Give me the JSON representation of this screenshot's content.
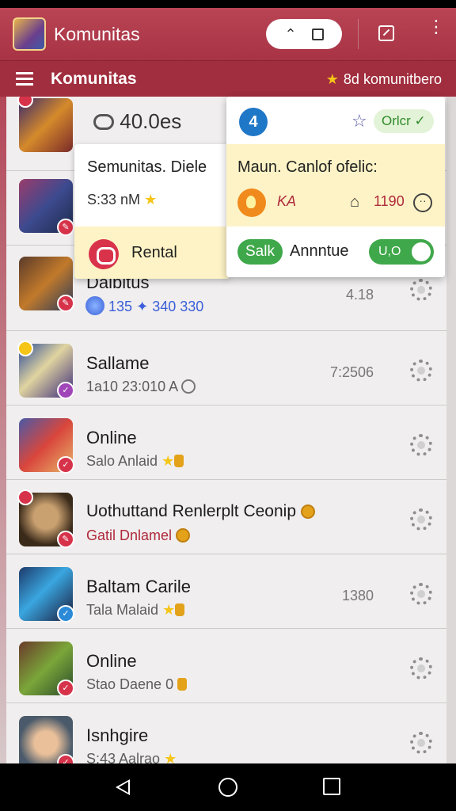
{
  "app_bar": {
    "title": "Komunitas"
  },
  "sub_bar": {
    "title": "Komunitas",
    "right_label": "8d komunitbero"
  },
  "rows": [
    {
      "title": "40.0es",
      "subtitle": "S:33 nM",
      "meta": ""
    },
    {
      "title": "Dalbitus",
      "subtitle": "135",
      "subtitle2": "340 330",
      "meta": "4.18"
    },
    {
      "title": "Sallame",
      "subtitle": "1a10 23:010 A",
      "meta": "7:2506"
    },
    {
      "title": "Online",
      "subtitle": "Salo Anlaid",
      "meta": ""
    },
    {
      "title": "Uothuttand Renlerplt Ceonip",
      "subtitle": "Gatil Dnlamel",
      "meta": ""
    },
    {
      "title": "Baltam Carile",
      "subtitle": "Tala Malaid",
      "meta": "1380"
    },
    {
      "title": "Online",
      "subtitle": "Stao Daene 0",
      "meta": ""
    },
    {
      "title": "Isnhgire",
      "subtitle": "S:43 Aalrao",
      "meta": ""
    }
  ],
  "popup_left": {
    "title": "Semunitas. Diele",
    "subtitle": "S:33 nM",
    "footer_label": "Rental"
  },
  "popup_right": {
    "avatar": "4",
    "status": "Orlcr ✓",
    "title": "Maun. Canlof ofelic:",
    "label": "KA",
    "number": "1190",
    "pill": "Salk",
    "footer_label": "Annntue",
    "toggle": "U,O"
  },
  "colors": {
    "accent": "#a73344",
    "green": "#3fa84a",
    "highlight": "#fdf3c6"
  }
}
